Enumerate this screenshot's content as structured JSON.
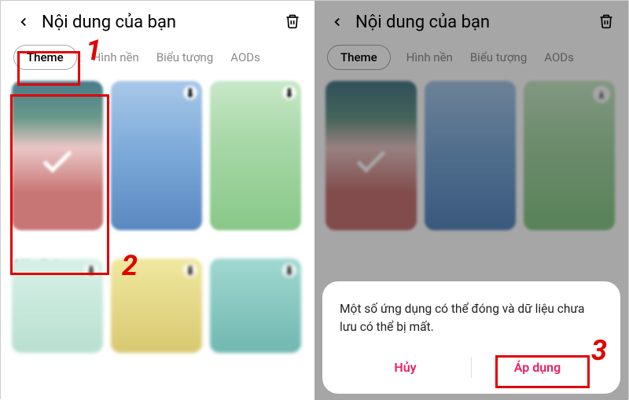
{
  "colors": {
    "accent": "#e91e63",
    "marker": "#e30000"
  },
  "left": {
    "title": "Nội dung của bạn",
    "tabs": {
      "theme": "Theme",
      "wallpaper": "Hình nền",
      "icon": "Biểu tượng",
      "aod": "AODs"
    },
    "cards": {
      "default_label": "Mặc định"
    },
    "markers": {
      "one": "1",
      "two": "2"
    }
  },
  "right": {
    "title": "Nội dung của bạn",
    "tabs": {
      "theme": "Theme",
      "wallpaper": "Hình nền",
      "icon": "Biểu tượng",
      "aod": "AODs"
    },
    "dialog": {
      "message": "Một số ứng dụng có thể đóng và dữ liệu chưa lưu có thể bị mất.",
      "cancel": "Hủy",
      "apply": "Áp dụng"
    },
    "markers": {
      "three": "3"
    }
  }
}
